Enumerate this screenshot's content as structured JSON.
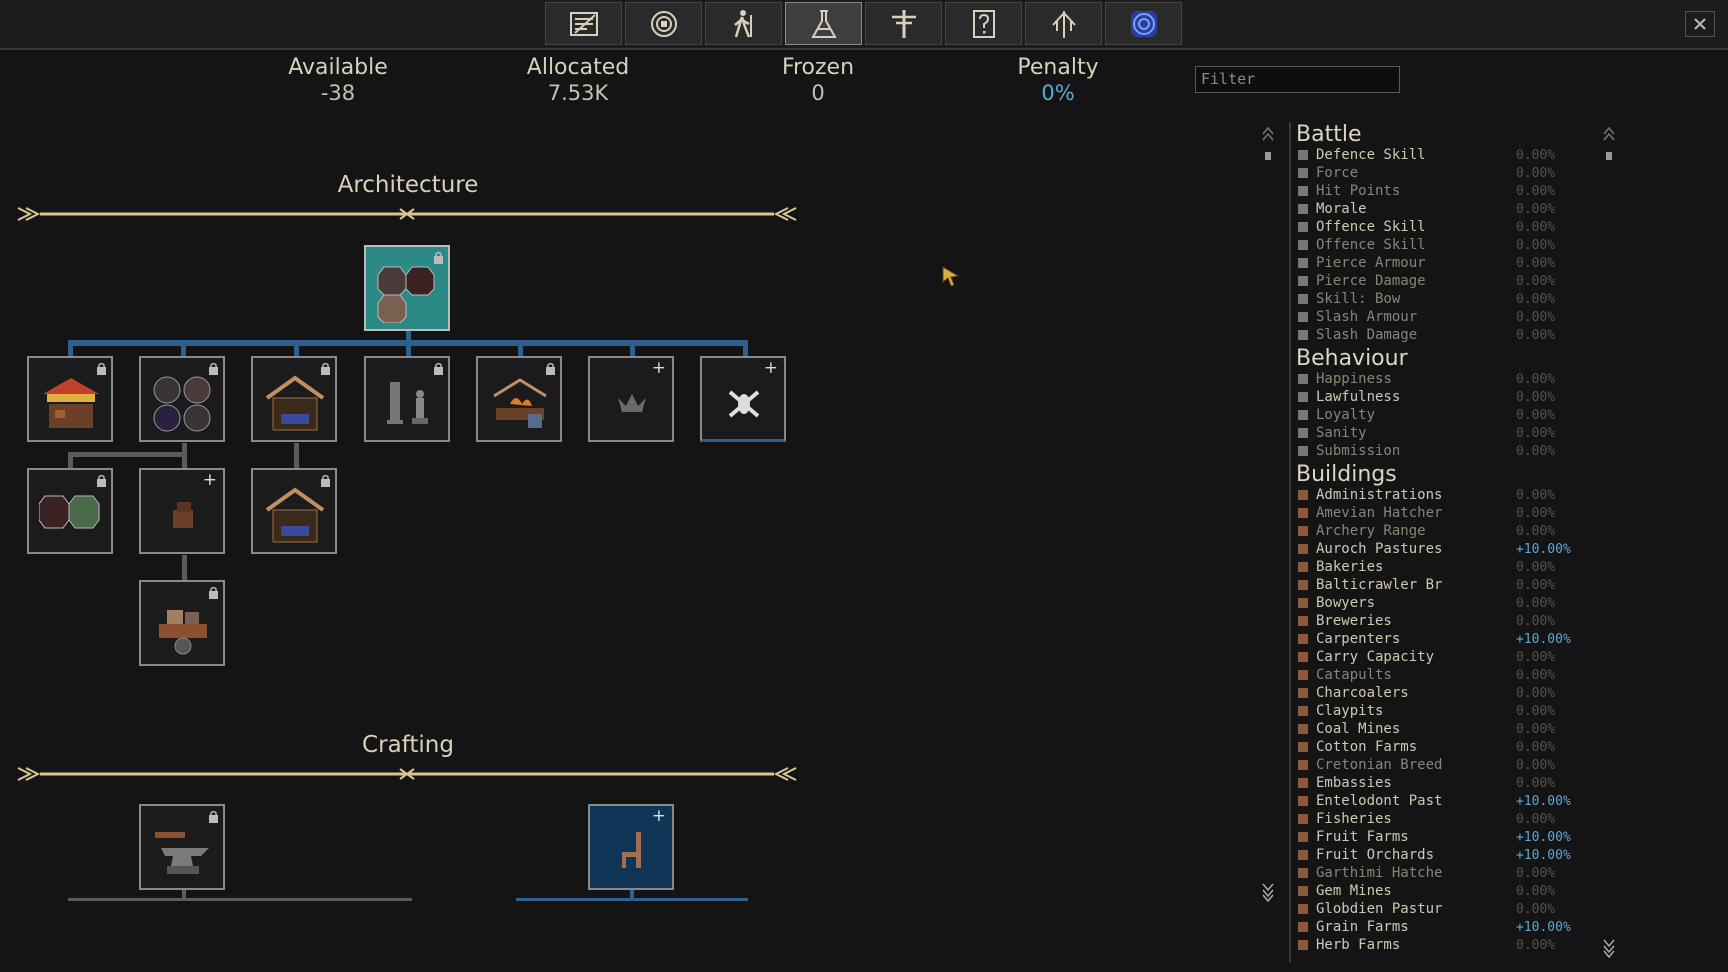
{
  "top_tabs": [
    {
      "name": "tab-ledger",
      "icon": "ledger-icon",
      "active": false
    },
    {
      "name": "tab-coin",
      "icon": "coin-icon",
      "active": false
    },
    {
      "name": "tab-walker",
      "icon": "walker-icon",
      "active": false
    },
    {
      "name": "tab-research",
      "icon": "flask-icon",
      "active": true
    },
    {
      "name": "tab-laws",
      "icon": "signpost-icon",
      "active": false
    },
    {
      "name": "tab-questions",
      "icon": "question-icon",
      "active": false
    },
    {
      "name": "tab-tree",
      "icon": "tree-icon",
      "active": false
    },
    {
      "name": "tab-map",
      "icon": "map-icon",
      "active": false
    }
  ],
  "stats": {
    "available": {
      "label": "Available",
      "value": "-38"
    },
    "allocated": {
      "label": "Allocated",
      "value": "7.53K"
    },
    "frozen": {
      "label": "Frozen",
      "value": "0"
    },
    "penalty": {
      "label": "Penalty",
      "value": "0%"
    }
  },
  "filter": {
    "placeholder": "Filter"
  },
  "sections": {
    "architecture": "Architecture",
    "crafting": "Crafting"
  },
  "colors": {
    "accent": "#5aa9d6",
    "teal": "#2b8a86",
    "tree_line": "#2d5f8f"
  },
  "bonus_panel": {
    "battle": {
      "title": "Battle",
      "rows": [
        {
          "name": "Defence Skill",
          "value": "0.00%"
        },
        {
          "name": "Force",
          "value": "0.00%"
        },
        {
          "name": "Hit Points",
          "value": "0.00%"
        },
        {
          "name": "Morale",
          "value": "0.00%"
        },
        {
          "name": "Offence Skill",
          "value": "0.00%"
        },
        {
          "name": "Offence Skill",
          "value": "0.00%"
        },
        {
          "name": "Pierce Armour",
          "value": "0.00%"
        },
        {
          "name": "Pierce Damage",
          "value": "0.00%"
        },
        {
          "name": "Skill: Bow",
          "value": "0.00%"
        },
        {
          "name": "Slash Armour",
          "value": "0.00%"
        },
        {
          "name": "Slash Damage",
          "value": "0.00%"
        }
      ]
    },
    "behaviour": {
      "title": "Behaviour",
      "rows": [
        {
          "name": "Happiness",
          "value": "0.00%"
        },
        {
          "name": "Lawfulness",
          "value": "0.00%"
        },
        {
          "name": "Loyalty",
          "value": "0.00%"
        },
        {
          "name": "Sanity",
          "value": "0.00%"
        },
        {
          "name": "Submission",
          "value": "0.00%"
        }
      ]
    },
    "buildings": {
      "title": "Buildings",
      "rows": [
        {
          "name": "Administrations",
          "value": "0.00%"
        },
        {
          "name": "Amevian Hatcher",
          "value": "0.00%"
        },
        {
          "name": "Archery Range",
          "value": "0.00%"
        },
        {
          "name": "Auroch Pastures",
          "value": "+10.00%"
        },
        {
          "name": "Bakeries",
          "value": "0.00%"
        },
        {
          "name": "Balticrawler Br",
          "value": "0.00%"
        },
        {
          "name": "Bowyers",
          "value": "0.00%"
        },
        {
          "name": "Breweries",
          "value": "0.00%"
        },
        {
          "name": "Carpenters",
          "value": "+10.00%"
        },
        {
          "name": "Carry Capacity",
          "value": "0.00%"
        },
        {
          "name": "Catapults",
          "value": "0.00%"
        },
        {
          "name": "Charcoalers",
          "value": "0.00%"
        },
        {
          "name": "Claypits",
          "value": "0.00%"
        },
        {
          "name": "Coal Mines",
          "value": "0.00%"
        },
        {
          "name": "Cotton Farms",
          "value": "0.00%"
        },
        {
          "name": "Cretonian Breed",
          "value": "0.00%"
        },
        {
          "name": "Embassies",
          "value": "0.00%"
        },
        {
          "name": "Entelodont Past",
          "value": "+10.00%"
        },
        {
          "name": "Fisheries",
          "value": "0.00%"
        },
        {
          "name": "Fruit Farms",
          "value": "+10.00%"
        },
        {
          "name": "Fruit Orchards",
          "value": "+10.00%"
        },
        {
          "name": "Garthimi Hatche",
          "value": "0.00%"
        },
        {
          "name": "Gem Mines",
          "value": "0.00%"
        },
        {
          "name": "Globdien Pastur",
          "value": "0.00%"
        },
        {
          "name": "Grain Farms",
          "value": "+10.00%"
        },
        {
          "name": "Herb Farms",
          "value": "0.00%"
        }
      ]
    }
  }
}
